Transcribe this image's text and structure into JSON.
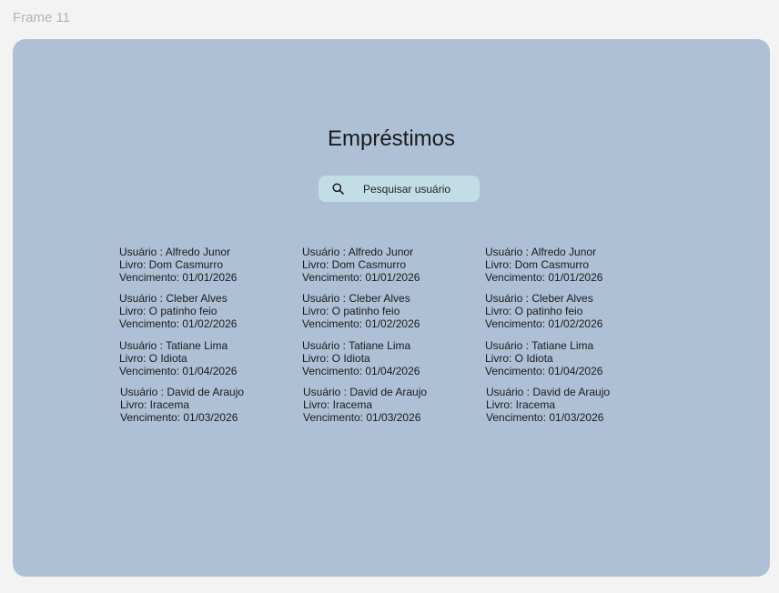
{
  "frame_label": "Frame 11",
  "page": {
    "title": "Empréstimos",
    "search_placeholder": "Pesquisar usuário"
  },
  "loans": [
    {
      "usuario": "Usuário : Alfredo Junor",
      "livro": "Livro: Dom Casmurro",
      "vencimento": "Vencimento: 01/01/2026"
    },
    {
      "usuario": "Usuário : Alfredo Junor",
      "livro": "Livro: Dom Casmurro",
      "vencimento": "Vencimento: 01/01/2026"
    },
    {
      "usuario": "Usuário : Alfredo Junor",
      "livro": "Livro: Dom Casmurro",
      "vencimento": "Vencimento: 01/01/2026"
    },
    {
      "usuario": "Usuário : Cleber Alves",
      "livro": "Livro: O patinho feio",
      "vencimento": "Vencimento: 01/02/2026"
    },
    {
      "usuario": "Usuário : Cleber Alves",
      "livro": "Livro: O patinho feio",
      "vencimento": "Vencimento: 01/02/2026"
    },
    {
      "usuario": "Usuário : Cleber Alves",
      "livro": "Livro: O patinho feio",
      "vencimento": "Vencimento: 01/02/2026"
    },
    {
      "usuario": "Usuário : Tatiane Lima",
      "livro": "Livro: O Idiota",
      "vencimento": "Vencimento: 01/04/2026"
    },
    {
      "usuario": "Usuário : Tatiane Lima",
      "livro": "Livro: O Idiota",
      "vencimento": "Vencimento: 01/04/2026"
    },
    {
      "usuario": "Usuário : Tatiane Lima",
      "livro": "Livro: O Idiota",
      "vencimento": "Vencimento: 01/04/2026"
    },
    {
      "usuario": "Usuário : David de Araujo",
      "livro": "Livro: Iracema",
      "vencimento": "Vencimento: 01/03/2026"
    },
    {
      "usuario": "Usuário : David de Araujo",
      "livro": "Livro: Iracema",
      "vencimento": "Vencimento: 01/03/2026"
    },
    {
      "usuario": "Usuário : David de Araujo",
      "livro": "Livro: Iracema",
      "vencimento": "Vencimento: 01/03/2026"
    }
  ],
  "colors": {
    "frame_bg": "#adc0d6",
    "search_bg": "#c3dde7",
    "canvas_bg": "#f3f3f3"
  },
  "icons": {
    "search": "search-icon"
  }
}
